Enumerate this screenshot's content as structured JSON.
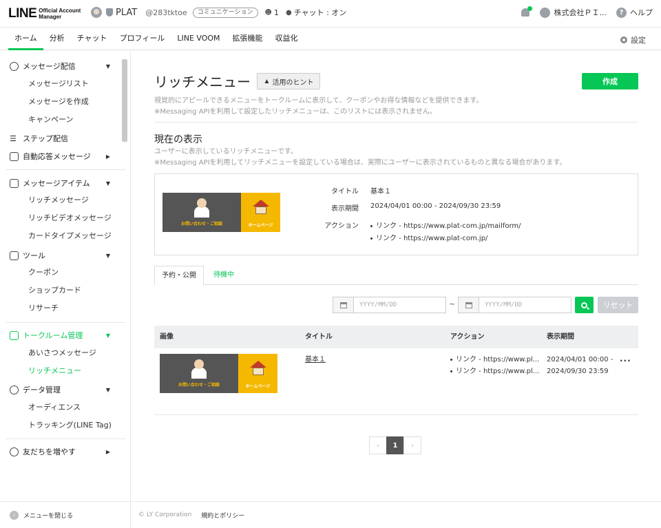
{
  "header": {
    "logo_main": "LINE",
    "logo_sub_line1": "Official Account",
    "logo_sub_line2": "Manager",
    "account_name": "PLAT",
    "account_id": "@283tktoe",
    "account_badge": "コミュニケーション",
    "friends_count": "1",
    "chat_status": "チャット : オン",
    "company": "株式会社ＰＩ...",
    "help": "ヘルプ"
  },
  "nav": {
    "tabs": [
      "ホーム",
      "分析",
      "チャット",
      "プロフィール",
      "LINE VOOM",
      "拡張機能",
      "収益化"
    ],
    "settings": "設定"
  },
  "sidebar": {
    "groups": [
      {
        "label": "メッセージ配信",
        "icon": "broadcast-icon",
        "expanded": true,
        "items": [
          "メッセージリスト",
          "メッセージを作成",
          "キャンペーン"
        ]
      },
      {
        "label": "ステップ配信",
        "icon": "step-icon",
        "expanded": false,
        "items": []
      },
      {
        "label": "自動応答メッセージ",
        "icon": "auto-reply-icon",
        "expanded": false,
        "items": []
      },
      {
        "label": "メッセージアイテム",
        "icon": "message-item-icon",
        "expanded": true,
        "items": [
          "リッチメッセージ",
          "リッチビデオメッセージ",
          "カードタイプメッセージ"
        ]
      },
      {
        "label": "ツール",
        "icon": "tools-icon",
        "expanded": true,
        "items": [
          "クーポン",
          "ショップカード",
          "リサーチ"
        ]
      },
      {
        "label": "トークルーム管理",
        "icon": "talkroom-icon",
        "expanded": true,
        "items": [
          "あいさつメッセージ",
          "リッチメニュー"
        ]
      },
      {
        "label": "データ管理",
        "icon": "database-icon",
        "expanded": true,
        "items": [
          "オーディエンス",
          "トラッキング(LINE Tag)"
        ]
      },
      {
        "label": "友だちを増やす",
        "icon": "add-friend-icon",
        "expanded": false,
        "items": []
      }
    ],
    "close_menu": "メニューを閉じる"
  },
  "page": {
    "title": "リッチメニュー",
    "hint_button": "活用のヒント",
    "create_button": "作成",
    "desc1": "視覚的にアピールできるメニューをトークルームに表示して、クーポンやお得な情報などを提供できます。",
    "desc2": "※Messaging APIを利用して設定したリッチメニューは、このリストには表示されません。"
  },
  "current": {
    "title": "現在の表示",
    "desc1": "ユーザーに表示しているリッチメニューです。",
    "desc2": "※Messaging APIを利用してリッチメニューを設定している場合は、実際にユーザーに表示されているものと異なる場合があります。",
    "image_left_text": "お問い合わせ・ご相談",
    "image_right_text": "ホームページ",
    "label_title": "タイトル",
    "value_title": "基本１",
    "label_period": "表示期間",
    "value_period": "2024/04/01 00:00 - 2024/09/30 23:59",
    "label_action": "アクション",
    "actions": [
      "リンク - https://www.plat-com.jp/mailform/",
      "リンク - https://www.plat-com.jp/"
    ]
  },
  "tabs": {
    "active": "予約・公開",
    "other": "待機中"
  },
  "filter": {
    "date_placeholder": "YYYY/MM/DD",
    "tilde": "~",
    "reset": "リセット"
  },
  "table": {
    "headers": [
      "画像",
      "タイトル",
      "アクション",
      "表示期間"
    ],
    "rows": [
      {
        "title": "基本１",
        "actions": [
          "リンク - https://www.pl...",
          "リンク - https://www.pl..."
        ],
        "period_start": "2024/04/01 00:00 -",
        "period_end": "2024/09/30 23:59",
        "more": "···"
      }
    ]
  },
  "pagination": {
    "prev": "‹",
    "current": "1",
    "next": "›"
  },
  "footer": {
    "copyright": "© LY Corporation",
    "policy": "規約とポリシー"
  },
  "colors": {
    "accent": "#06c755",
    "rich_menu_yellow": "#f5b800",
    "rich_menu_gray": "#555555"
  }
}
